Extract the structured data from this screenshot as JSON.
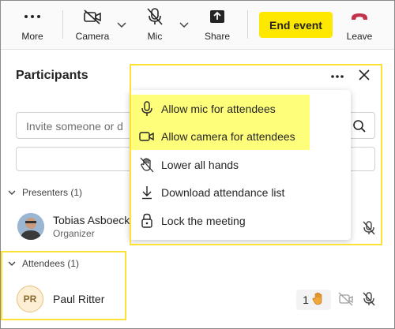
{
  "toolbar": {
    "more_label": "More",
    "camera_label": "Camera",
    "mic_label": "Mic",
    "share_label": "Share",
    "end_event_label": "End event",
    "leave_label": "Leave"
  },
  "panel": {
    "title": "Participants",
    "invite_placeholder": "Invite someone or d"
  },
  "menu": {
    "items": [
      {
        "label": "Allow mic for attendees",
        "icon": "mic-icon"
      },
      {
        "label": "Allow camera for attendees",
        "icon": "video-camera-icon"
      },
      {
        "label": "Lower all hands",
        "icon": "hand-lower-icon"
      },
      {
        "label": "Download attendance list",
        "icon": "download-icon"
      },
      {
        "label": "Lock the meeting",
        "icon": "lock-icon"
      }
    ]
  },
  "presenters": {
    "header": "Presenters (1)",
    "people": [
      {
        "name": "Tobias Asboeck",
        "role": "Organizer"
      }
    ]
  },
  "attendees": {
    "header": "Attendees (1)",
    "people": [
      {
        "name": "Paul Ritter",
        "initials": "PR",
        "raised_hands": "1"
      }
    ]
  },
  "colors": {
    "highlight": "#ffe800",
    "leave_red": "#c4314b"
  }
}
